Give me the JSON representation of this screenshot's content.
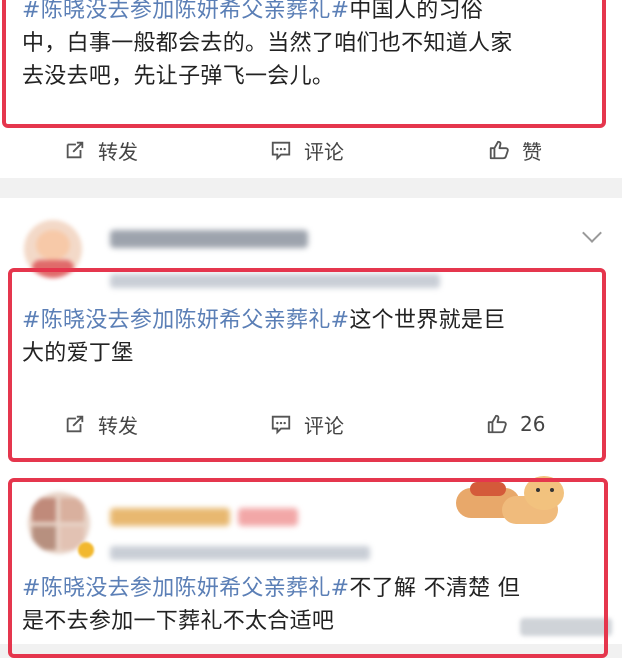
{
  "posts": [
    {
      "topic": "#陈晓没去参加陈妍希父亲葬礼#",
      "line1_rest": "中国人的习俗",
      "line2": "中，白事一般都会去的。当然了咱们也不知道人家",
      "line3": "去没去吧，先让子弹飞一会儿。",
      "repost_label": "转发",
      "comment_label": "评论",
      "like_label": "赞"
    },
    {
      "topic": "#陈晓没去参加陈妍希父亲葬礼#",
      "line1_rest": "这个世界就是巨",
      "line2": "大的爱丁堡",
      "repost_label": "转发",
      "comment_label": "评论",
      "like_count": "26"
    },
    {
      "topic": "#陈晓没去参加陈妍希父亲葬礼#",
      "line1_rest": "不了解 不清楚 但",
      "line2": "是不去参加一下葬礼不太合适吧"
    }
  ],
  "colors": {
    "topic": "#5b7fb6",
    "highlight_box": "#e5364d",
    "text": "#222222",
    "action": "#444444"
  },
  "icons": [
    "repost-icon",
    "comment-icon",
    "like-icon",
    "chevron-down-icon"
  ]
}
